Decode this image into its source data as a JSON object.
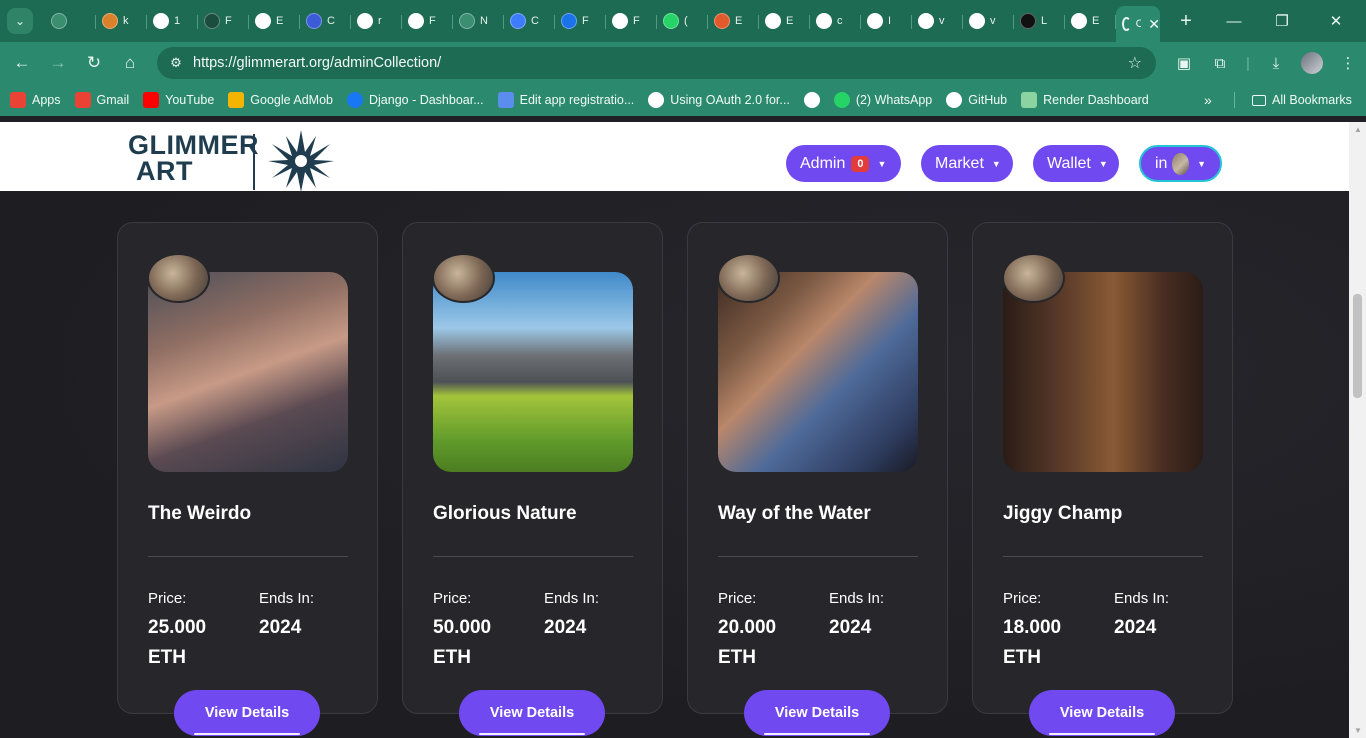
{
  "browser": {
    "tabs": [
      {
        "label": "",
        "color": "#3c8e70",
        "icon": "globe-icon"
      },
      {
        "label": "k",
        "color": "#d9822b",
        "icon": "chart-icon"
      },
      {
        "label": "1",
        "color": "#ffffff",
        "icon": "circle-icon"
      },
      {
        "label": "F",
        "color": "#1b4d3e",
        "icon": "django-icon"
      },
      {
        "label": "E",
        "color": "#ffffff",
        "icon": "github-icon"
      },
      {
        "label": "C",
        "color": "#3b5bd9",
        "icon": "cloud-icon"
      },
      {
        "label": "r",
        "color": "#ffffff",
        "icon": "openai-icon"
      },
      {
        "label": "F",
        "color": "#ffffff",
        "icon": "openai-icon"
      },
      {
        "label": "N",
        "color": "#3c8e70",
        "icon": "globe-icon"
      },
      {
        "label": "C",
        "color": "#3d7bff",
        "icon": "gemini-icon"
      },
      {
        "label": "F",
        "color": "#1a73e8",
        "icon": "flag-icon"
      },
      {
        "label": "F",
        "color": "#ffffff",
        "icon": "link-icon"
      },
      {
        "label": "(",
        "color": "#25d366",
        "icon": "whatsapp-icon"
      },
      {
        "label": "E",
        "color": "#e05a2b",
        "icon": "circle-icon"
      },
      {
        "label": "E",
        "color": "#ffffff",
        "icon": "doc-icon"
      },
      {
        "label": "c",
        "color": "#ffffff",
        "icon": "link-icon"
      },
      {
        "label": "I",
        "color": "#ffffff",
        "icon": "openai-icon"
      },
      {
        "label": "v",
        "color": "#ffffff",
        "icon": "circle-icon"
      },
      {
        "label": "v",
        "color": "#ffffff",
        "icon": "loading-icon"
      },
      {
        "label": "L",
        "color": "#111111",
        "icon": "play-icon"
      },
      {
        "label": "E",
        "color": "#ffffff",
        "icon": "camera-icon"
      }
    ],
    "active_tab": {
      "label": "C",
      "close": "✕"
    },
    "new_tab": "+",
    "window": {
      "minimize": "—",
      "restore": "❐",
      "close": "✕"
    },
    "url": "https://glimmerart.org/adminCollection/",
    "bookmarks": [
      {
        "label": "Apps",
        "icon": "apps-icon",
        "color": "#ea4335"
      },
      {
        "label": "Gmail",
        "icon": "gmail-icon",
        "color": "#ea4335"
      },
      {
        "label": "YouTube",
        "icon": "youtube-icon",
        "color": "#ff0000"
      },
      {
        "label": "Google AdMob",
        "icon": "admob-icon",
        "color": "#f4b400"
      },
      {
        "label": "Django - Dashboar...",
        "icon": "facebook-icon",
        "color": "#1877f2"
      },
      {
        "label": "Edit app registratio...",
        "icon": "api-icon",
        "color": "#5b8def"
      },
      {
        "label": "Using OAuth 2.0 for...",
        "icon": "google-icon",
        "color": "#ffffff"
      },
      {
        "label": "",
        "icon": "globe-icon",
        "color": "#ffffff"
      },
      {
        "label": "(2) WhatsApp",
        "icon": "whatsapp-icon",
        "color": "#25d366"
      },
      {
        "label": "GitHub",
        "icon": "github-icon",
        "color": "#ffffff"
      },
      {
        "label": "Render Dashboard",
        "icon": "render-icon",
        "color": "#8bd3a0"
      }
    ],
    "bookmarks_more": "»",
    "all_bookmarks": "All Bookmarks"
  },
  "site": {
    "logo_line1": "GLIMMER",
    "logo_line2": "ART",
    "nav": {
      "admin": "Admin",
      "admin_badge": "0",
      "market": "Market",
      "wallet": "Wallet",
      "user": "in"
    },
    "colors": {
      "accent": "#7149f0",
      "badge": "#e13b3b",
      "user_ring": "#24c4d4"
    }
  },
  "cards": [
    {
      "title": "The Weirdo",
      "price_label": "Price:",
      "price_line1": "25.000",
      "price_line2": "ETH",
      "ends_label": "Ends In:",
      "ends_value": "2024",
      "button": "View Details"
    },
    {
      "title": "Glorious Nature",
      "price_label": "Price:",
      "price_line1": "50.000",
      "price_line2": "ETH",
      "ends_label": "Ends In:",
      "ends_value": "2024",
      "button": "View Details"
    },
    {
      "title": "Way of the Water",
      "price_label": "Price:",
      "price_line1": "20.000",
      "price_line2": "ETH",
      "ends_label": "Ends In:",
      "ends_value": "2024",
      "button": "View Details"
    },
    {
      "title": "Jiggy Champ",
      "price_label": "Price:",
      "price_line1": "18.000",
      "price_line2": "ETH",
      "ends_label": "Ends In:",
      "ends_value": "2024",
      "button": "View Details"
    }
  ]
}
